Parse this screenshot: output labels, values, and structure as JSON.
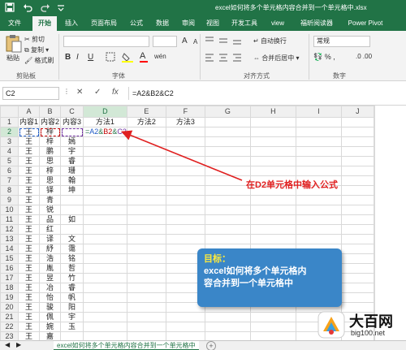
{
  "titlebar": {
    "save_icon": "save-icon",
    "undo_icon": "undo-icon",
    "redo_icon": "redo-icon",
    "title": "excel如何将多个单元格内容合并到一个单元格中.xlsx"
  },
  "tabs": [
    "文件",
    "开始",
    "插入",
    "页面布局",
    "公式",
    "数据",
    "审阅",
    "视图",
    "开发工具",
    "view",
    "福昕阅读器",
    "Power Pivot"
  ],
  "active_tab": "开始",
  "ribbon": {
    "paste_label": "粘贴",
    "cut_label": "剪切",
    "copy_label": "复制",
    "format_painter_label": "格式刷",
    "font_grow": "A",
    "font_shrink": "A",
    "bold": "B",
    "italic": "I",
    "underline": "U",
    "wen_glyph": "wén",
    "wrap_label": "自动换行",
    "merge_label": "合并后居中",
    "number_format": "常规",
    "groups": {
      "clipboard": "剪贴板",
      "font": "字体",
      "alignment": "对齐方式",
      "number": "数字"
    }
  },
  "formula_bar": {
    "name_box": "C2",
    "cancel": "✕",
    "confirm": "✓",
    "fx": "fx",
    "formula": "=A2&B2&C2"
  },
  "grid": {
    "columns": [
      "A",
      "B",
      "C",
      "D",
      "E",
      "F",
      "G",
      "H",
      "I",
      "J"
    ],
    "selected_column": "D",
    "header_row": [
      "内容1",
      "内容2",
      "内容3",
      "方法1",
      "方法2",
      "方法3",
      "",
      "",
      "",
      ""
    ],
    "edit_formula": {
      "eq": "=",
      "a": "A2",
      "amp1": "&",
      "b": "B2",
      "amp2": "&",
      "c": "C2"
    },
    "rows": [
      [
        "王",
        "梓",
        ""
      ],
      [
        "王",
        "梓",
        "嫣"
      ],
      [
        "王",
        "鹏",
        "宇"
      ],
      [
        "王",
        "思",
        "睿"
      ],
      [
        "王",
        "梓",
        "珊"
      ],
      [
        "王",
        "思",
        "翰"
      ],
      [
        "王",
        "铎",
        "坤"
      ],
      [
        "王",
        "青",
        ""
      ],
      [
        "王",
        "锐",
        ""
      ],
      [
        "王",
        "品",
        "如"
      ],
      [
        "王",
        "红",
        ""
      ],
      [
        "王",
        "译",
        "文"
      ],
      [
        "王",
        "紓",
        "霭"
      ],
      [
        "王",
        "浩",
        "铭"
      ],
      [
        "王",
        "胤",
        "哲"
      ],
      [
        "王",
        "昱",
        "竹"
      ],
      [
        "王",
        "冶",
        "睿"
      ],
      [
        "王",
        "怡",
        "帆"
      ],
      [
        "王",
        "骏",
        "阳"
      ],
      [
        "王",
        "佩",
        "宇"
      ],
      [
        "王",
        "婉",
        "玉"
      ],
      [
        "王",
        "嘉",
        ""
      ]
    ]
  },
  "annotation": {
    "arrow_text": "在D2单元格中输入公式",
    "goal_title": "目标：",
    "goal_line1": "excel如何将多个单元格内",
    "goal_line2": "容合并到一个单元格中"
  },
  "sheet_tabs": {
    "active": "excel如何将多个单元格内容合并到一个单元格中",
    "add": "+"
  },
  "watermark": {
    "big": "大百网",
    "small": "big100.net"
  },
  "colors": {
    "brand": "#217346",
    "annotation_red": "#e02020",
    "goal_blue": "#3a86c8",
    "goal_yellow": "#ffeb3b"
  }
}
